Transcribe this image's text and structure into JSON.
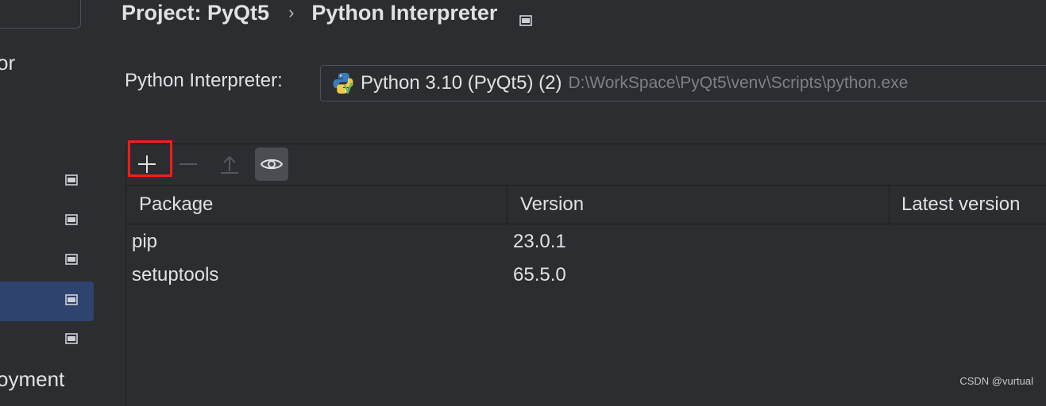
{
  "sidebar": {
    "partial_top_label": "or",
    "partial_bottom_label": "oyment",
    "items": [
      {
        "icon": "window-icon",
        "selected": false
      },
      {
        "icon": "window-icon",
        "selected": false
      },
      {
        "icon": "window-icon",
        "selected": false
      },
      {
        "icon": "window-icon",
        "selected": true
      },
      {
        "icon": "window-icon",
        "selected": false
      }
    ]
  },
  "breadcrumb": {
    "project": "Project: PyQt5",
    "separator": "›",
    "page": "Python Interpreter",
    "icon": "window-icon"
  },
  "interpreter": {
    "label": "Python Interpreter:",
    "name": "Python 3.10 (PyQt5) (2)",
    "path": "D:\\WorkSpace\\PyQt5\\venv\\Scripts\\python.exe",
    "icon": "python-logo-icon"
  },
  "toolbar": {
    "add": "+",
    "remove": "−",
    "upgrade": "upgrade-icon",
    "show_early": "eye-icon",
    "highlight_color": "#ff1a1a"
  },
  "packages": {
    "columns": [
      "Package",
      "Version",
      "Latest version"
    ],
    "rows": [
      {
        "package": "pip",
        "version": "23.0.1",
        "latest": ""
      },
      {
        "package": "setuptools",
        "version": "65.5.0",
        "latest": ""
      }
    ]
  },
  "watermark": "CSDN @vurtual",
  "colors": {
    "background": "#2b2d30",
    "selected": "#2e436e",
    "text": "#dfe1e5",
    "muted": "#7d8088"
  }
}
